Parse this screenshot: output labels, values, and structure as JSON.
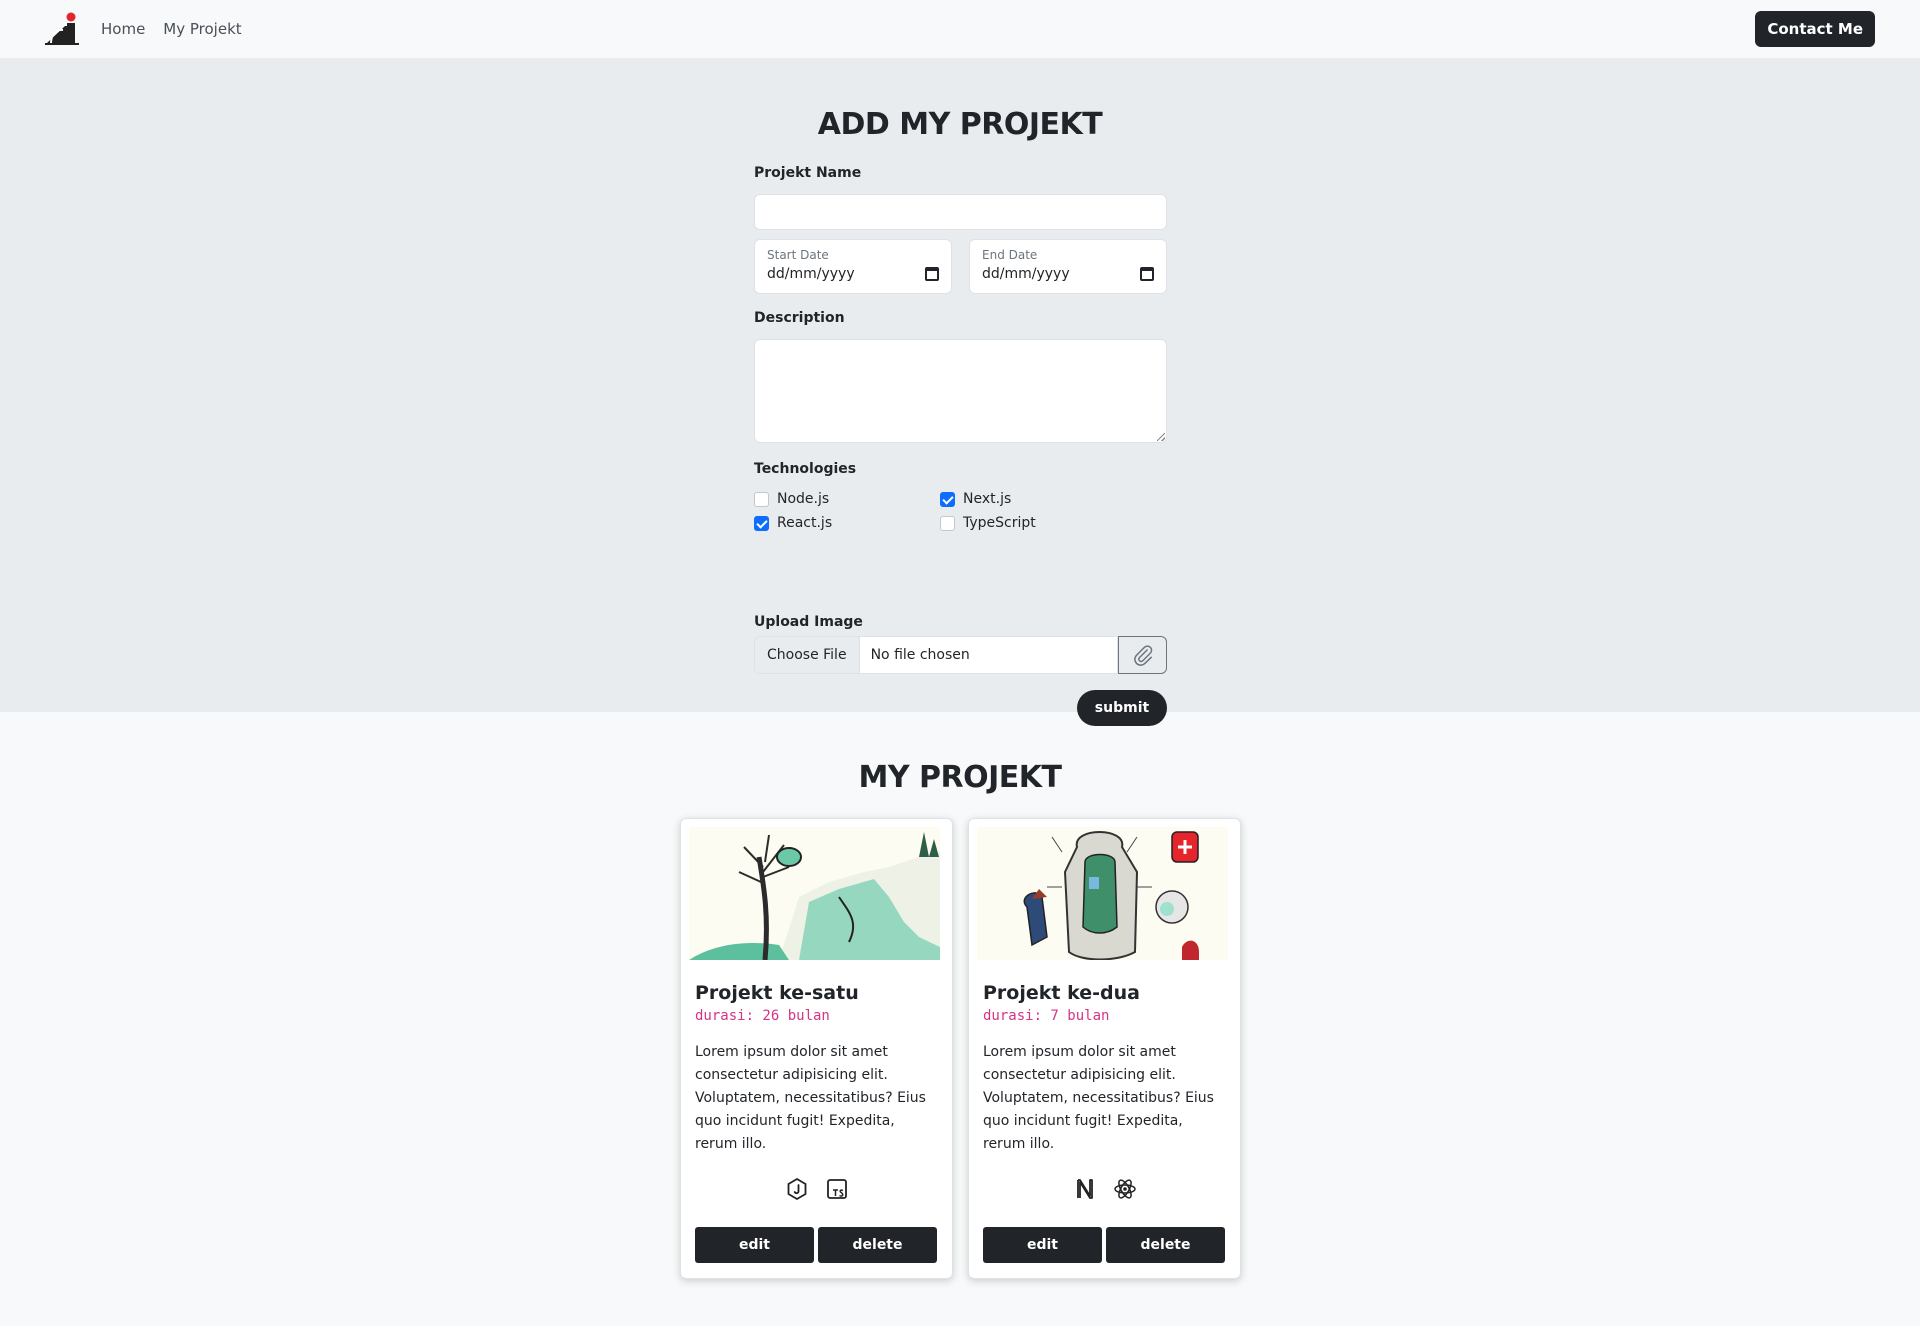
{
  "nav": {
    "links": [
      "Home",
      "My Projekt"
    ],
    "contact_label": "Contact Me"
  },
  "form": {
    "title": "ADD MY PROJEKT",
    "name_label": "Projekt Name",
    "name_value": "",
    "start_date_label": "Start Date",
    "start_date_value": "dd/mm/yyyy",
    "end_date_label": "End Date",
    "end_date_value": "dd/mm/yyyy",
    "description_label": "Description",
    "description_value": "",
    "technologies_label": "Technologies",
    "technologies": [
      {
        "label": "Node.js",
        "checked": false
      },
      {
        "label": "Next.js",
        "checked": true
      },
      {
        "label": "React.js",
        "checked": true
      },
      {
        "label": "TypeScript",
        "checked": false
      }
    ],
    "upload_label": "Upload Image",
    "choose_file_label": "Choose File",
    "no_file_label": "No file chosen",
    "submit_label": "submit"
  },
  "projects": {
    "title": "MY PROJEKT",
    "cards": [
      {
        "title": "Projekt ke-satu",
        "duration": "durasi: 26 bulan",
        "description": "Lorem ipsum dolor sit amet consectetur adipisicing elit. Voluptatem, necessitatibus? Eius quo incidunt fugit! Expedita, rerum illo.",
        "tech_icons": [
          "javascript-icon",
          "typescript-icon"
        ],
        "edit_label": "edit",
        "delete_label": "delete"
      },
      {
        "title": "Projekt ke-dua",
        "duration": "durasi: 7 bulan",
        "description": "Lorem ipsum dolor sit amet consectetur adipisicing elit. Voluptatem, necessitatibus? Eius quo incidunt fugit! Expedita, rerum illo.",
        "tech_icons": [
          "nextjs-icon",
          "react-icon"
        ],
        "edit_label": "edit",
        "delete_label": "delete"
      }
    ]
  },
  "colors": {
    "dark": "#212529",
    "accent_blue": "#0d6efd",
    "duration_pink": "#d63384",
    "form_bg": "#e9ecef",
    "page_bg": "#f8f9fa"
  }
}
